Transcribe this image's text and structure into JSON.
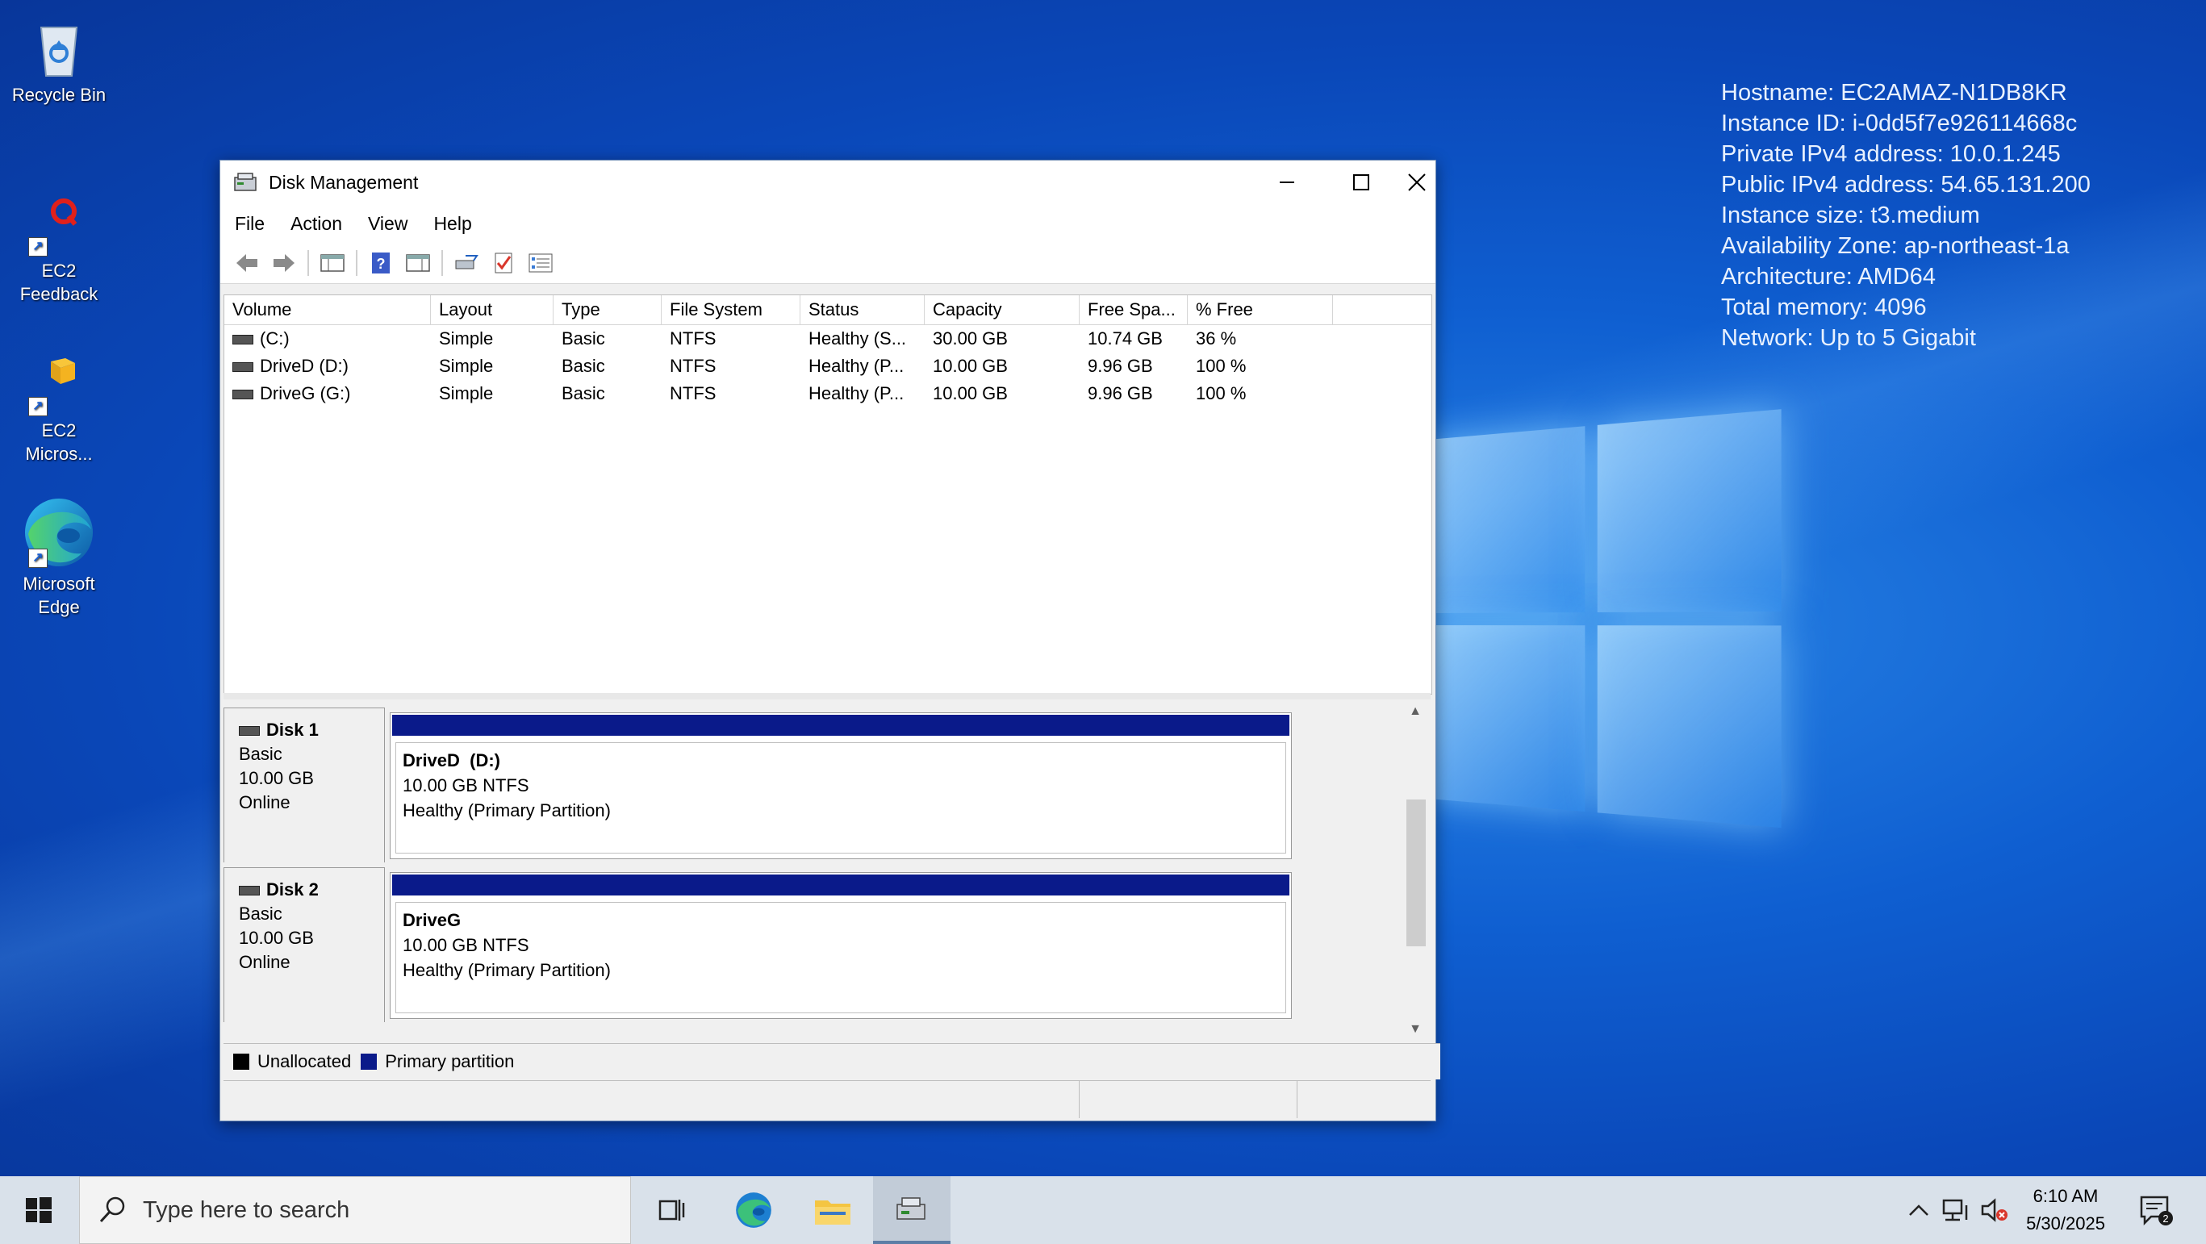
{
  "desktop": {
    "icons": [
      {
        "label": "Recycle Bin"
      },
      {
        "label": "EC2 Feedback"
      },
      {
        "label": "EC2 Micros..."
      },
      {
        "label": "Microsoft Edge"
      }
    ],
    "sysinfo": [
      "Hostname: EC2AMAZ-N1DB8KR",
      "Instance ID: i-0dd5f7e926114668c",
      "Private IPv4 address: 10.0.1.245",
      "Public IPv4 address: 54.65.131.200",
      "Instance size: t3.medium",
      "Availability Zone: ap-northeast-1a",
      "Architecture: AMD64",
      "Total memory: 4096",
      "Network: Up to 5 Gigabit"
    ]
  },
  "window": {
    "title": "Disk Management",
    "menu": [
      "File",
      "Action",
      "View",
      "Help"
    ],
    "columns": [
      "Volume",
      "Layout",
      "Type",
      "File System",
      "Status",
      "Capacity",
      "Free Spa...",
      "% Free"
    ],
    "volumes": [
      [
        "(C:)",
        "Simple",
        "Basic",
        "NTFS",
        "Healthy (S...",
        "30.00 GB",
        "10.74 GB",
        "36 %"
      ],
      [
        "DriveD (D:)",
        "Simple",
        "Basic",
        "NTFS",
        "Healthy (P...",
        "10.00 GB",
        "9.96 GB",
        "100 %"
      ],
      [
        "DriveG (G:)",
        "Simple",
        "Basic",
        "NTFS",
        "Healthy (P...",
        "10.00 GB",
        "9.96 GB",
        "100 %"
      ]
    ],
    "disks": [
      {
        "name": "Disk 1",
        "type": "Basic",
        "size": "10.00 GB",
        "state": "Online",
        "partition": {
          "name": "DriveD  (D:)",
          "fs": "10.00 GB NTFS",
          "status": "Healthy (Primary Partition)"
        }
      },
      {
        "name": "Disk 2",
        "type": "Basic",
        "size": "10.00 GB",
        "state": "Online",
        "partition": {
          "name": "DriveG",
          "fs": "10.00 GB NTFS",
          "status": "Healthy (Primary Partition)"
        }
      }
    ],
    "legend": [
      {
        "label": "Unallocated",
        "color": "#000000"
      },
      {
        "label": "Primary partition",
        "color": "#0a1a8a"
      }
    ]
  },
  "taskbar": {
    "search_placeholder": "Type here to search",
    "time": "6:10 AM",
    "date": "5/30/2025",
    "notification_count": "2"
  }
}
